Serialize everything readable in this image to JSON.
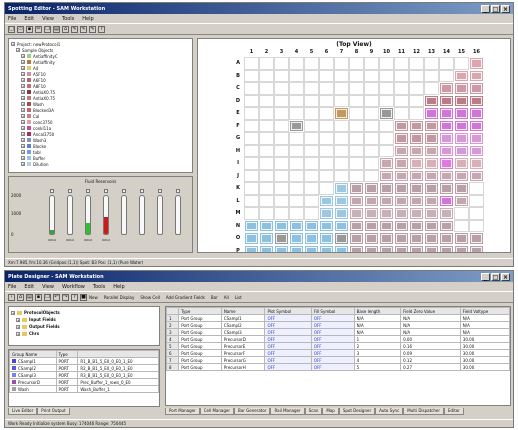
{
  "top": {
    "title": "Spotting Editor - SAM Workstation",
    "menu": [
      "File",
      "Edit",
      "View",
      "Tools",
      "Help"
    ],
    "toolbar_icons": [
      "new-icon",
      "open-icon",
      "save-icon",
      "cut-icon",
      "copy-icon",
      "print-icon",
      "home-icon",
      "tool-icon",
      "tool-icon",
      "tool-icon",
      "help-icon"
    ],
    "tree": [
      {
        "label": "Project: newProtocol1",
        "color": "",
        "indent": 0
      },
      {
        "label": "Sample Objects",
        "color": "",
        "indent": 1
      },
      {
        "label": "AntiaffinityC",
        "color": "#9ed17a",
        "indent": 2
      },
      {
        "label": "Antiaffinity",
        "color": "#b07a3a",
        "indent": 2
      },
      {
        "label": "A4",
        "color": "#d3d36a",
        "indent": 2
      },
      {
        "label": "A5F10",
        "color": "#d090a0",
        "indent": 2
      },
      {
        "label": "A6F10",
        "color": "#b06868",
        "indent": 2
      },
      {
        "label": "A8F10",
        "color": "#c07070",
        "indent": 2
      },
      {
        "label": "AntiaX0.75",
        "color": "#8a3a3a",
        "indent": 2
      },
      {
        "label": "AntiaX0.75",
        "color": "#c07a80",
        "indent": 2
      },
      {
        "label": "Wash",
        "color": "#a05050",
        "indent": 2
      },
      {
        "label": "Blocked3A",
        "color": "#c06868",
        "indent": 2
      },
      {
        "label": "Cal",
        "color": "#d08080",
        "indent": 2
      },
      {
        "label": "conc3750",
        "color": "#e0a0a0",
        "indent": 2
      },
      {
        "label": "conkl11a",
        "color": "#c05090",
        "indent": 2
      },
      {
        "label": "Ancal3750",
        "color": "#a03060",
        "indent": 2
      },
      {
        "label": "Wash3",
        "color": "#8090c0",
        "indent": 2
      },
      {
        "label": "Blocke",
        "color": "#6080d0",
        "indent": 2
      },
      {
        "label": "tobl",
        "color": "#70a0e0",
        "indent": 2
      },
      {
        "label": "Buffer",
        "color": "#a0c0e0",
        "indent": 2
      },
      {
        "label": "Dilution",
        "color": "#b0d0f0",
        "indent": 2
      }
    ],
    "volume_title": "Fluid Reservoirs",
    "volume_ticks": [
      "2000",
      "1000",
      "0"
    ],
    "tubes": [
      {
        "level": 0.1,
        "color": "#3ca03c"
      },
      {
        "level": 0.0,
        "color": "#3ca03c"
      },
      {
        "level": 0.28,
        "color": "#2ec02e"
      },
      {
        "level": 0.45,
        "color": "#d01818"
      },
      {
        "level": 0.0,
        "color": "#3ca03c"
      },
      {
        "level": 0.0,
        "color": "#3ca03c"
      },
      {
        "level": 0.0,
        "color": "#3ca03c"
      },
      {
        "level": 0.0,
        "color": "#3ca03c"
      }
    ],
    "tube_labels": [
      "0014",
      "0014",
      "0014",
      "0014",
      "",
      "",
      "",
      ""
    ],
    "plate_title": "(Top View)",
    "col_labels": [
      "1",
      "2",
      "3",
      "4",
      "5",
      "6",
      "7",
      "8",
      "9",
      "10",
      "11",
      "12",
      "13",
      "14",
      "15",
      "16"
    ],
    "row_labels": [
      "A",
      "B",
      "C",
      "D",
      "E",
      "F",
      "G",
      "H",
      "I",
      "J",
      "K",
      "L",
      "M",
      "N",
      "O",
      "P"
    ],
    "status": "Xm:7.985,Ym:10.36 (Gridpos:(1,1)) Spot: B3 Pos: (1,1) (Pure Water)"
  },
  "bottom": {
    "title": "Plate Designer - SAM Workstation",
    "menu": [
      "File",
      "Edit",
      "View",
      "Workflow",
      "Tools",
      "Help"
    ],
    "toolbar_icons": [
      "back-icon",
      "home-icon",
      "print-icon",
      "save-icon",
      "copy-icon",
      "undo-icon",
      "redo-icon",
      "help-icon",
      "stop-icon"
    ],
    "toolbar_actions": [
      "New",
      "Parallel Display",
      "Show Cell",
      "Add Gradient Fields",
      "Bar",
      "All",
      "List"
    ],
    "tree": [
      {
        "label": "ProtocolObjects",
        "indent": 0
      },
      {
        "label": "Input Fields",
        "indent": 1
      },
      {
        "label": "Output Fields",
        "indent": 1
      },
      {
        "label": "Chrs",
        "indent": 1
      }
    ],
    "group_cols": [
      "Group Name",
      "Type"
    ],
    "groups": [
      {
        "name": "CSampl1",
        "color": "#4a4ad0",
        "type": "PORT",
        "desc": "R1_B_B1_5_E0_0_E0_1_E0"
      },
      {
        "name": "CSampl2",
        "color": "#5a5ad8",
        "type": "PORT",
        "desc": "R2_B_B1_5_E0_0_E0_1_E0"
      },
      {
        "name": "CSampl3",
        "color": "#8080e0",
        "type": "PORT",
        "desc": "R3_B_B1_5_E0_0_E0_1_E0"
      },
      {
        "name": "PrecursorD",
        "color": "#a050a0",
        "type": "PORT",
        "desc": "Prec_Buffer_1_rows_0_E0"
      },
      {
        "name": "Wash",
        "color": "#a0a0a0",
        "type": "PORT",
        "desc": "Wash_Buffer_1"
      }
    ],
    "side_tabs": [
      "Live Editor",
      "Print Output"
    ],
    "table_cols": [
      "",
      "Type",
      "Name",
      "Plot Symbol",
      "Fill Symbol",
      "Base length",
      "Field Zero Value",
      "Field Valtype"
    ],
    "table_rows": [
      [
        "1",
        "Port Group",
        "CSampl1",
        "OFF",
        "OFF",
        "N/A",
        "N/A",
        "N/A"
      ],
      [
        "2",
        "Port Group",
        "CSampl2",
        "OFF",
        "OFF",
        "N/A",
        "N/A",
        "N/A"
      ],
      [
        "3",
        "Port Group",
        "CSampl3",
        "OFF",
        "OFF",
        "N/A",
        "N/A",
        "N/A"
      ],
      [
        "4",
        "Port Group",
        "PrecursorD",
        "OFF",
        "OFF",
        "1",
        "0.00",
        "30.00"
      ],
      [
        "5",
        "Port Group",
        "PrecursorE",
        "OFF",
        "OFF",
        "2",
        "0.16",
        "30.00"
      ],
      [
        "6",
        "Port Group",
        "PrecursorF",
        "OFF",
        "OFF",
        "3",
        "0.09",
        "30.00"
      ],
      [
        "7",
        "Port Group",
        "PrecursorG",
        "OFF",
        "OFF",
        "4",
        "0.12",
        "30.00"
      ],
      [
        "8",
        "Port Group",
        "PrecursorH",
        "OFF",
        "OFF",
        "5",
        "0.27",
        "30.00"
      ]
    ],
    "bottom_tabs": [
      "Port Manager",
      "Cell Manager",
      "Bar Generator",
      "Rail Manager",
      "Scan",
      "Map",
      "Spot Designer",
      "Auto Sync",
      "Multi Dispatcher",
      "Editor"
    ],
    "status": "Work Ready    Initialize system  Busy: 174046 Range: 750445"
  },
  "plate_cells": [
    {
      "r": 0,
      "c": 15,
      "color": "#d9a7ad"
    },
    {
      "r": 1,
      "c": 14,
      "color": "#d9a7ad"
    },
    {
      "r": 1,
      "c": 15,
      "color": "#d9a7ad"
    },
    {
      "r": 2,
      "c": 13,
      "color": "#cc9aa6"
    },
    {
      "r": 2,
      "c": 14,
      "color": "#cc9aa6"
    },
    {
      "r": 2,
      "c": 15,
      "color": "#cc9aa6"
    },
    {
      "r": 3,
      "c": 12,
      "color": "#b77e87"
    },
    {
      "r": 3,
      "c": 13,
      "color": "#b77e87"
    },
    {
      "r": 3,
      "c": 14,
      "color": "#b77e87"
    },
    {
      "r": 3,
      "c": 15,
      "color": "#b77e87"
    },
    {
      "r": 4,
      "c": 6,
      "color": "#c59860"
    },
    {
      "r": 4,
      "c": 9,
      "color": "#999999"
    },
    {
      "r": 4,
      "c": 12,
      "color": "#d077d6"
    },
    {
      "r": 4,
      "c": 13,
      "color": "#d077d6"
    },
    {
      "r": 4,
      "c": 14,
      "color": "#d077d6"
    },
    {
      "r": 4,
      "c": 15,
      "color": "#d077d6"
    },
    {
      "r": 5,
      "c": 3,
      "color": "#999999"
    },
    {
      "r": 5,
      "c": 10,
      "color": "#c09aa0"
    },
    {
      "r": 5,
      "c": 11,
      "color": "#c09aa0"
    },
    {
      "r": 5,
      "c": 12,
      "color": "#c09aa0"
    },
    {
      "r": 5,
      "c": 13,
      "color": "#d077d6"
    },
    {
      "r": 5,
      "c": 14,
      "color": "#d077d6"
    },
    {
      "r": 5,
      "c": 15,
      "color": "#d077d6"
    },
    {
      "r": 6,
      "c": 10,
      "color": "#c09aa0"
    },
    {
      "r": 6,
      "c": 11,
      "color": "#c09aa0"
    },
    {
      "r": 6,
      "c": 12,
      "color": "#c09aa0"
    },
    {
      "r": 6,
      "c": 13,
      "color": "#d59ad6"
    },
    {
      "r": 6,
      "c": 14,
      "color": "#d59ad6"
    },
    {
      "r": 6,
      "c": 15,
      "color": "#d59ad6"
    },
    {
      "r": 7,
      "c": 10,
      "color": "#c8a8b0"
    },
    {
      "r": 7,
      "c": 11,
      "color": "#c8a8b0"
    },
    {
      "r": 7,
      "c": 12,
      "color": "#c8a8b0"
    },
    {
      "r": 7,
      "c": 13,
      "color": "#d59ad6"
    },
    {
      "r": 7,
      "c": 14,
      "color": "#d59ad6"
    },
    {
      "r": 7,
      "c": 15,
      "color": "#d59ad6"
    },
    {
      "r": 8,
      "c": 9,
      "color": "#c8a8b0"
    },
    {
      "r": 8,
      "c": 10,
      "color": "#c8a8b0"
    },
    {
      "r": 8,
      "c": 11,
      "color": "#d8b0b8"
    },
    {
      "r": 8,
      "c": 12,
      "color": "#d8b0b8"
    },
    {
      "r": 8,
      "c": 13,
      "color": "#e07ae0"
    },
    {
      "r": 8,
      "c": 14,
      "color": "#d8b0b8"
    },
    {
      "r": 8,
      "c": 15,
      "color": "#d8b0b8"
    },
    {
      "r": 9,
      "c": 9,
      "color": "#c8a8b0"
    },
    {
      "r": 9,
      "c": 10,
      "color": "#c8a8b0"
    },
    {
      "r": 9,
      "c": 11,
      "color": "#c8a8b0"
    },
    {
      "r": 9,
      "c": 12,
      "color": "#c8a8b0"
    },
    {
      "r": 9,
      "c": 13,
      "color": "#c8a8b0"
    },
    {
      "r": 9,
      "c": 14,
      "color": "#c8a8b0"
    },
    {
      "r": 9,
      "c": 15,
      "color": "#c8a8b0"
    },
    {
      "r": 10,
      "c": 6,
      "color": "#9ec8e0"
    },
    {
      "r": 10,
      "c": 7,
      "color": "#b8a0a8"
    },
    {
      "r": 10,
      "c": 8,
      "color": "#b8a0a8"
    },
    {
      "r": 10,
      "c": 9,
      "color": "#b8a0a8"
    },
    {
      "r": 10,
      "c": 10,
      "color": "#b8a0a8"
    },
    {
      "r": 10,
      "c": 11,
      "color": "#b8a0a8"
    },
    {
      "r": 10,
      "c": 12,
      "color": "#b8a0a8"
    },
    {
      "r": 10,
      "c": 13,
      "color": "#b8a0a8"
    },
    {
      "r": 10,
      "c": 14,
      "color": "#b8a0a8"
    },
    {
      "r": 11,
      "c": 5,
      "color": "#9ec8e0"
    },
    {
      "r": 11,
      "c": 6,
      "color": "#9ec8e0"
    },
    {
      "r": 11,
      "c": 7,
      "color": "#c0a8b0"
    },
    {
      "r": 11,
      "c": 8,
      "color": "#c0a8b0"
    },
    {
      "r": 11,
      "c": 9,
      "color": "#c0a8b0"
    },
    {
      "r": 11,
      "c": 10,
      "color": "#c0a8b0"
    },
    {
      "r": 11,
      "c": 11,
      "color": "#c0a8b0"
    },
    {
      "r": 11,
      "c": 12,
      "color": "#c0a8b0"
    },
    {
      "r": 11,
      "c": 13,
      "color": "#d077d6"
    },
    {
      "r": 11,
      "c": 14,
      "color": "#c0a8b0"
    },
    {
      "r": 12,
      "c": 5,
      "color": "#9ec8e0"
    },
    {
      "r": 12,
      "c": 6,
      "color": "#9ec8e0"
    },
    {
      "r": 12,
      "c": 7,
      "color": "#c8b0b8"
    },
    {
      "r": 12,
      "c": 8,
      "color": "#c8b0b8"
    },
    {
      "r": 12,
      "c": 9,
      "color": "#c8b0b8"
    },
    {
      "r": 12,
      "c": 10,
      "color": "#c8b0b8"
    },
    {
      "r": 12,
      "c": 11,
      "color": "#c8b0b8"
    },
    {
      "r": 12,
      "c": 12,
      "color": "#c8b0b8"
    },
    {
      "r": 12,
      "c": 13,
      "color": "#c8b0b8"
    },
    {
      "r": 13,
      "c": 0,
      "color": "#8ec0e0"
    },
    {
      "r": 13,
      "c": 1,
      "color": "#8ec0e0"
    },
    {
      "r": 13,
      "c": 2,
      "color": "#8ec0e0"
    },
    {
      "r": 13,
      "c": 3,
      "color": "#8ec0e0"
    },
    {
      "r": 13,
      "c": 4,
      "color": "#8ec0e0"
    },
    {
      "r": 13,
      "c": 5,
      "color": "#8ec0e0"
    },
    {
      "r": 13,
      "c": 6,
      "color": "#8ec0e0"
    },
    {
      "r": 13,
      "c": 7,
      "color": "#b8a0a8"
    },
    {
      "r": 13,
      "c": 8,
      "color": "#b8a0a8"
    },
    {
      "r": 13,
      "c": 9,
      "color": "#b8a0a8"
    },
    {
      "r": 13,
      "c": 10,
      "color": "#b8a0a8"
    },
    {
      "r": 13,
      "c": 11,
      "color": "#b8a0a8"
    },
    {
      "r": 13,
      "c": 12,
      "color": "#b8a0a8"
    },
    {
      "r": 13,
      "c": 13,
      "color": "#b8a0a8"
    },
    {
      "r": 14,
      "c": 0,
      "color": "#8ec0e0"
    },
    {
      "r": 14,
      "c": 1,
      "color": "#8ec0e0"
    },
    {
      "r": 14,
      "c": 2,
      "color": "#999999"
    },
    {
      "r": 14,
      "c": 3,
      "color": "#8ec0e0"
    },
    {
      "r": 14,
      "c": 4,
      "color": "#8ec0e0"
    },
    {
      "r": 14,
      "c": 5,
      "color": "#8ec0e0"
    },
    {
      "r": 14,
      "c": 6,
      "color": "#999999"
    },
    {
      "r": 14,
      "c": 7,
      "color": "#b8a0a8"
    },
    {
      "r": 14,
      "c": 8,
      "color": "#b8a0a8"
    },
    {
      "r": 14,
      "c": 9,
      "color": "#b8a0a8"
    },
    {
      "r": 14,
      "c": 10,
      "color": "#b8a0a8"
    },
    {
      "r": 14,
      "c": 11,
      "color": "#b8a0a8"
    },
    {
      "r": 14,
      "c": 12,
      "color": "#b8a0a8"
    },
    {
      "r": 14,
      "c": 13,
      "color": "#b8a0a8"
    },
    {
      "r": 14,
      "c": 14,
      "color": "#b8a0a8"
    },
    {
      "r": 14,
      "c": 15,
      "color": "#b8a0a8"
    },
    {
      "r": 15,
      "c": 0,
      "color": "#8ec0e0"
    },
    {
      "r": 15,
      "c": 1,
      "color": "#8ec0e0"
    },
    {
      "r": 15,
      "c": 2,
      "color": "#8ec0e0"
    },
    {
      "r": 15,
      "c": 3,
      "color": "#8ec0e0"
    },
    {
      "r": 15,
      "c": 4,
      "color": "#8ec0e0"
    },
    {
      "r": 15,
      "c": 5,
      "color": "#8ec0e0"
    },
    {
      "r": 15,
      "c": 6,
      "color": "#8ec0e0"
    },
    {
      "r": 15,
      "c": 7,
      "color": "#b8a0a8"
    },
    {
      "r": 15,
      "c": 8,
      "color": "#b8a0a8"
    },
    {
      "r": 15,
      "c": 9,
      "color": "#b8a0a8"
    },
    {
      "r": 15,
      "c": 10,
      "color": "#b8a0a8"
    },
    {
      "r": 15,
      "c": 11,
      "color": "#b8a0a8"
    },
    {
      "r": 15,
      "c": 12,
      "color": "#b8a0a8"
    },
    {
      "r": 15,
      "c": 13,
      "color": "#b8a0a8"
    },
    {
      "r": 15,
      "c": 14,
      "color": "#b8a0a8"
    },
    {
      "r": 15,
      "c": 15,
      "color": "#b8a0a8"
    }
  ]
}
